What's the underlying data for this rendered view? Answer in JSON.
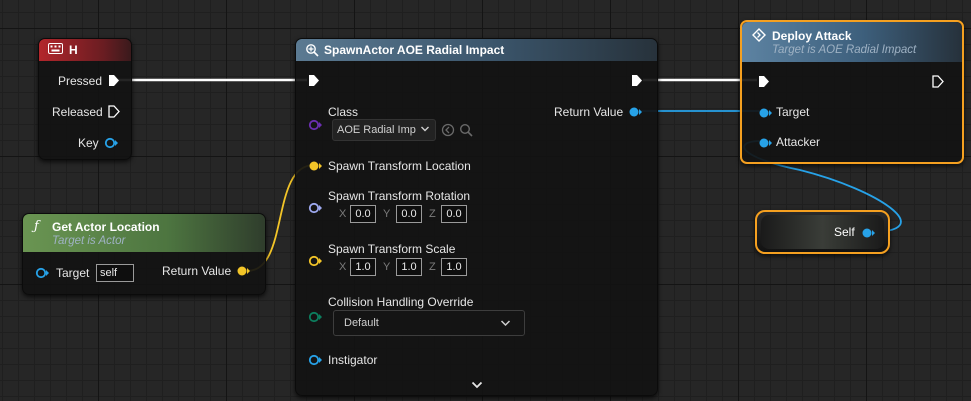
{
  "colors": {
    "exec": "#ffffff",
    "object_pin": "#27a2e8",
    "vector_pin": "#f3c528",
    "rotator_pin": "#9ea9f0",
    "byte_pin": "#0c7e5e",
    "class_pin": "#6b2fb0",
    "selection": "#f5a020",
    "event_header": "#a8262b",
    "function_header_green": "#5f8a4a",
    "function_header_blue": "#3f5f7a"
  },
  "event_node": {
    "title": "H",
    "icon": "keyboard-icon",
    "pins": {
      "pressed": "Pressed",
      "released": "Released",
      "key": "Key"
    }
  },
  "get_location_node": {
    "title": "Get Actor Location",
    "subtitle": "Target is Actor",
    "icon": "function-icon",
    "target_label": "Target",
    "target_value": "self",
    "return_label": "Return Value"
  },
  "spawn_node": {
    "title": "SpawnActor AOE Radial Impact",
    "icon": "spawn-icon",
    "class_label": "Class",
    "class_value": "AOE Radial Imp",
    "return_label": "Return Value",
    "location_label": "Spawn Transform Location",
    "rotation_label": "Spawn Transform Rotation",
    "rotation": {
      "x_label": "X",
      "x": "0.0",
      "y_label": "Y",
      "y": "0.0",
      "z_label": "Z",
      "z": "0.0"
    },
    "scale_label": "Spawn Transform Scale",
    "scale": {
      "x_label": "X",
      "x": "1.0",
      "y_label": "Y",
      "y": "1.0",
      "z_label": "Z",
      "z": "1.0"
    },
    "collision_label": "Collision Handling Override",
    "collision_value": "Default",
    "instigator_label": "Instigator",
    "expand_icon": "chevron-down-icon"
  },
  "deploy_node": {
    "title": "Deploy Attack",
    "subtitle": "Target is AOE Radial Impact",
    "icon": "diamond-icon",
    "target_label": "Target",
    "attacker_label": "Attacker"
  },
  "self_node": {
    "label": "Self"
  }
}
